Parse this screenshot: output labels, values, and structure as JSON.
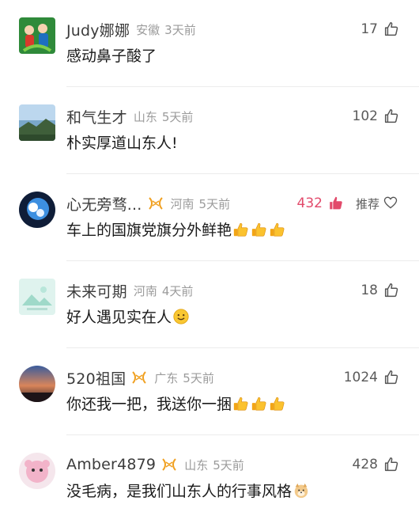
{
  "comments": [
    {
      "name": "Judy娜娜",
      "badge": false,
      "location": "安徽",
      "time": "3天前",
      "likes": "17",
      "liked": false,
      "recommend": "",
      "text": "感动鼻子酸了",
      "emoji": [],
      "avatar": "avatar-cartoon"
    },
    {
      "name": "和气生才",
      "badge": false,
      "location": "山东",
      "time": "5天前",
      "likes": "102",
      "liked": false,
      "recommend": "",
      "text": "朴实厚道山东人!",
      "emoji": [],
      "avatar": "avatar-landscape"
    },
    {
      "name": "心无旁骛...",
      "badge": true,
      "location": "河南",
      "time": "5天前",
      "likes": "432",
      "liked": true,
      "recommend": "推荐",
      "text": "车上的国旗党旗分外鲜艳",
      "emoji": [
        "thumbs-up-emoji",
        "thumbs-up-emoji",
        "thumbs-up-emoji"
      ],
      "avatar": "avatar-sky"
    },
    {
      "name": "未来可期",
      "badge": false,
      "location": "河南",
      "time": "4天前",
      "likes": "18",
      "liked": false,
      "recommend": "",
      "text": "好人遇见实在人",
      "emoji": [
        "smile-emoji"
      ],
      "avatar": "avatar-placeholder"
    },
    {
      "name": "520祖国",
      "badge": true,
      "location": "广东",
      "time": "5天前",
      "likes": "1024",
      "liked": false,
      "recommend": "",
      "text": "你还我一把，我送你一捆",
      "emoji": [
        "thumbs-up-emoji",
        "thumbs-up-emoji",
        "thumbs-up-emoji"
      ],
      "avatar": "avatar-sunset"
    },
    {
      "name": "Amber4879",
      "badge": true,
      "location": "山东",
      "time": "5天前",
      "likes": "428",
      "liked": false,
      "recommend": "",
      "text": "没毛病，是我们山东人的行事风格",
      "emoji": [
        "doge-emoji"
      ],
      "avatar": "avatar-doll"
    }
  ],
  "colors": {
    "liked": "#e24a6b",
    "meta": "#9b9b9b",
    "badge": "#f0a020"
  }
}
